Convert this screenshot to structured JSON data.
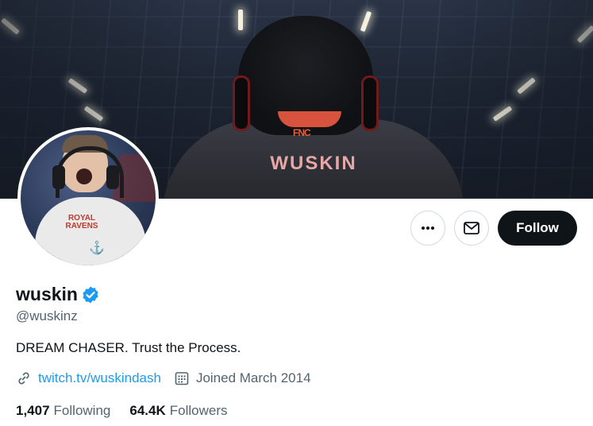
{
  "banner": {
    "jersey_text": "WUSKIN",
    "jersey_logo": "FNC"
  },
  "avatar": {
    "shirt_text": "ROYAL RAVENS"
  },
  "actions": {
    "more_icon": "more-dots-icon",
    "message_icon": "mail-icon",
    "follow_label": "Follow"
  },
  "profile": {
    "display_name": "wuskin",
    "verified_icon": "verified-badge-icon",
    "handle": "@wuskinz",
    "bio": "DREAM CHASER. Trust the Process.",
    "link": "twitch.tv/wuskindash",
    "joined": "Joined March 2014"
  },
  "stats": {
    "following_count": "1,407",
    "following_label": "Following",
    "followers_count": "64.4K",
    "followers_label": "Followers"
  },
  "colors": {
    "accent": "#1d9bf0",
    "text_primary": "#0f1419",
    "text_secondary": "#536471",
    "follow_bg": "#0f1419"
  }
}
